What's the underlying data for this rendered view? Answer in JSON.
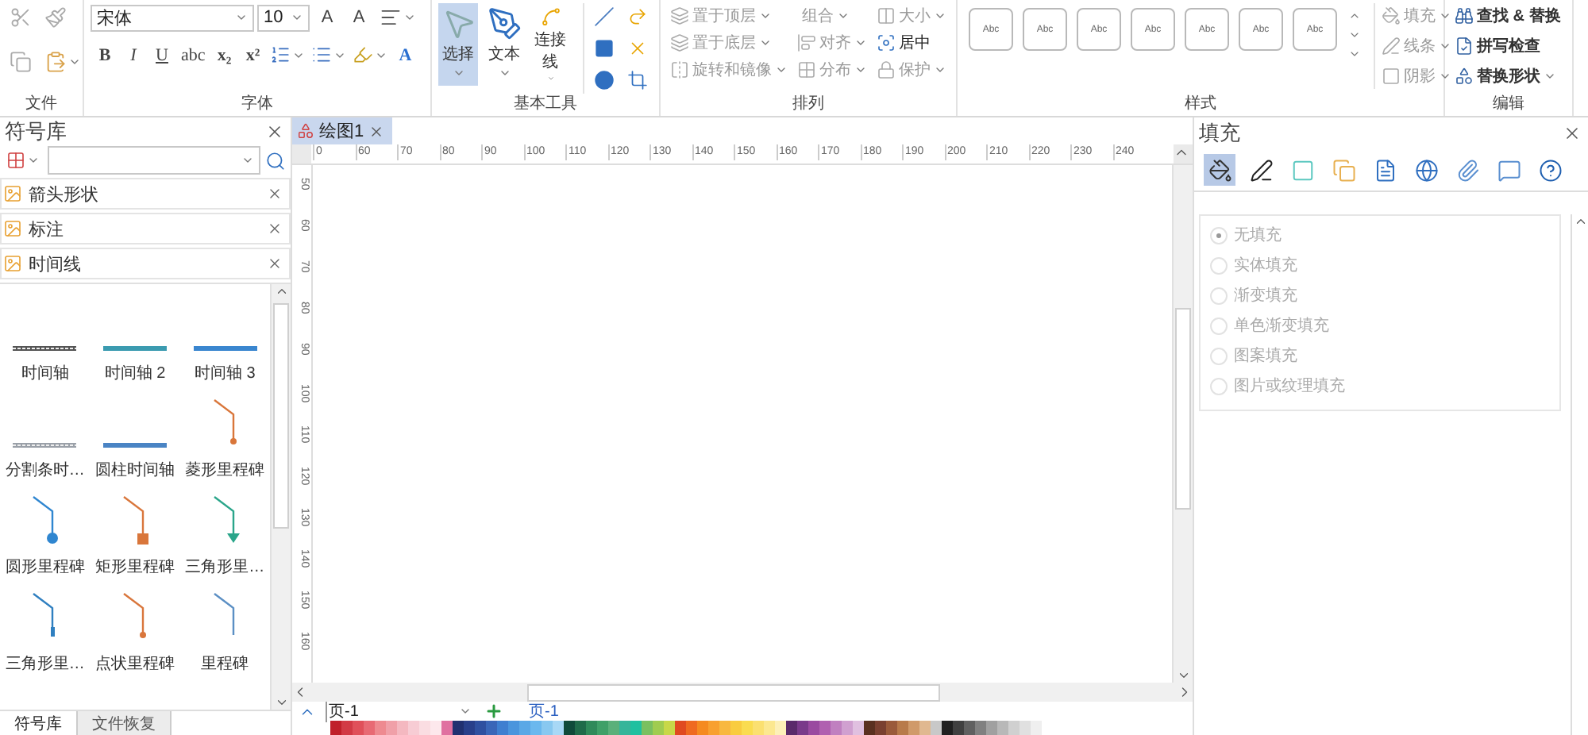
{
  "ribbon": {
    "groups": [
      {
        "kind": "file",
        "label": "文件"
      },
      {
        "kind": "font",
        "label": "字体",
        "font": "宋体",
        "size": "10",
        "size_buttons": [
          "A",
          "A"
        ],
        "format_buttons": [
          "B",
          "I",
          "U",
          "abc",
          "x₂",
          "x²"
        ],
        "color_button": "A"
      },
      {
        "kind": "tools",
        "label": "基本工具",
        "tools": [
          {
            "label": "选择",
            "selected": true
          },
          {
            "label": "文本",
            "selected": false
          },
          {
            "label": "连接线",
            "selected": false
          }
        ]
      },
      {
        "kind": "arrange",
        "label": "排列",
        "actions": [
          {
            "label": "置于顶层",
            "disabled": true
          },
          {
            "label": "置于底层",
            "disabled": true
          },
          {
            "label": "旋转和镜像",
            "disabled": true
          },
          {
            "label": "组合",
            "disabled": true
          },
          {
            "label": "对齐",
            "disabled": true
          },
          {
            "label": "分布",
            "disabled": true
          },
          {
            "label": "大小",
            "disabled": true
          },
          {
            "label": "居中",
            "disabled": false
          },
          {
            "label": "保护",
            "disabled": true
          }
        ]
      },
      {
        "kind": "styles",
        "label": "样式",
        "swatches": [
          "Abc",
          "Abc",
          "Abc",
          "Abc",
          "Abc",
          "Abc",
          "Abc"
        ],
        "actions": [
          {
            "label": "填充",
            "disabled": true
          },
          {
            "label": "线条",
            "disabled": true
          },
          {
            "label": "阴影",
            "disabled": true
          }
        ]
      },
      {
        "kind": "edit",
        "label": "编辑",
        "actions": [
          "查找 & 替换",
          "拼写检查",
          "替换形状"
        ]
      }
    ]
  },
  "library": {
    "title": "符号库",
    "categories": [
      "箭头形状",
      "标注",
      "时间线"
    ],
    "shapes": [
      {
        "label": "时间轴",
        "kind": "line",
        "color": "#555555"
      },
      {
        "label": "时间轴 2",
        "kind": "line",
        "color": "#3b9bb0"
      },
      {
        "label": "时间轴 3",
        "kind": "line",
        "color": "#3a86cf"
      },
      {
        "label": "分割条时…",
        "kind": "line",
        "color": "#9aa0a8"
      },
      {
        "label": "圆柱时间轴",
        "kind": "line",
        "color": "#4a84c4"
      },
      {
        "label": "菱形里程碑",
        "kind": "milestone",
        "color": "#d9763a"
      },
      {
        "label": "圆形里程碑",
        "kind": "milestone",
        "color": "#2f86d0"
      },
      {
        "label": "矩形里程碑",
        "kind": "milestone",
        "color": "#d9763b"
      },
      {
        "label": "三角形里…",
        "kind": "milestone",
        "color": "#2aa58a"
      },
      {
        "label": "三角形里…",
        "kind": "milestone",
        "color": "#2f7fc0"
      },
      {
        "label": "点状里程碑",
        "kind": "milestone",
        "color": "#d9763c"
      },
      {
        "label": "里程碑",
        "kind": "milestone",
        "color": "#5b8fc4"
      }
    ],
    "bottom_tabs": [
      {
        "label": "符号库",
        "selected": true
      },
      {
        "label": "文件恢复",
        "selected": false
      }
    ]
  },
  "document": {
    "tab": "绘图1",
    "hruler": [
      "0",
      "60",
      "70",
      "80",
      "90",
      "100",
      "110",
      "120",
      "130",
      "140",
      "150",
      "160",
      "170",
      "180",
      "190",
      "200",
      "210",
      "220",
      "230",
      "240"
    ],
    "vruler": [
      "50",
      "60",
      "70",
      "80",
      "90",
      "100",
      "110",
      "120",
      "130",
      "140",
      "150",
      "160"
    ],
    "page_select": "页-1",
    "pages": [
      {
        "label": "页-1",
        "selected": true
      }
    ]
  },
  "fill_panel": {
    "title": "填充",
    "options": [
      {
        "label": "无填充",
        "selected": true
      },
      {
        "label": "实体填充",
        "selected": false
      },
      {
        "label": "渐变填充",
        "selected": false
      },
      {
        "label": "单色渐变填充",
        "selected": false
      },
      {
        "label": "图案填充",
        "selected": false
      },
      {
        "label": "图片或纹理填充",
        "selected": false
      }
    ]
  }
}
